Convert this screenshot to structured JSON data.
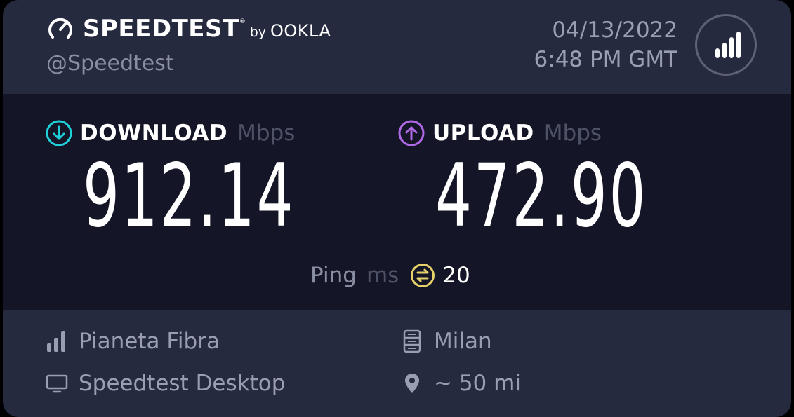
{
  "brand": {
    "name": "SPEEDTEST",
    "trademark": "®",
    "by": "by",
    "partner": "OOKLA",
    "handle": "@Speedtest"
  },
  "result_time": {
    "date": "04/13/2022",
    "time": "6:48 PM GMT"
  },
  "download": {
    "label": "DOWNLOAD",
    "unit": "Mbps",
    "value": "912.14",
    "icon": "arrow-down-circle-icon",
    "color": "#1fd0d8"
  },
  "upload": {
    "label": "UPLOAD",
    "unit": "Mbps",
    "value": "472.90",
    "icon": "arrow-up-circle-icon",
    "color": "#b06ae8"
  },
  "ping": {
    "label": "Ping",
    "unit": "ms",
    "value": "20",
    "icon": "ping-icon",
    "color": "#e5d06a"
  },
  "details": {
    "isp": "Pianeta Fibra",
    "client": "Speedtest Desktop",
    "server": "Milan",
    "distance": "~ 50 mi"
  },
  "colors": {
    "card_background": "#262a3f",
    "results_background": "#141526",
    "muted_text": "#9a9eb2"
  }
}
